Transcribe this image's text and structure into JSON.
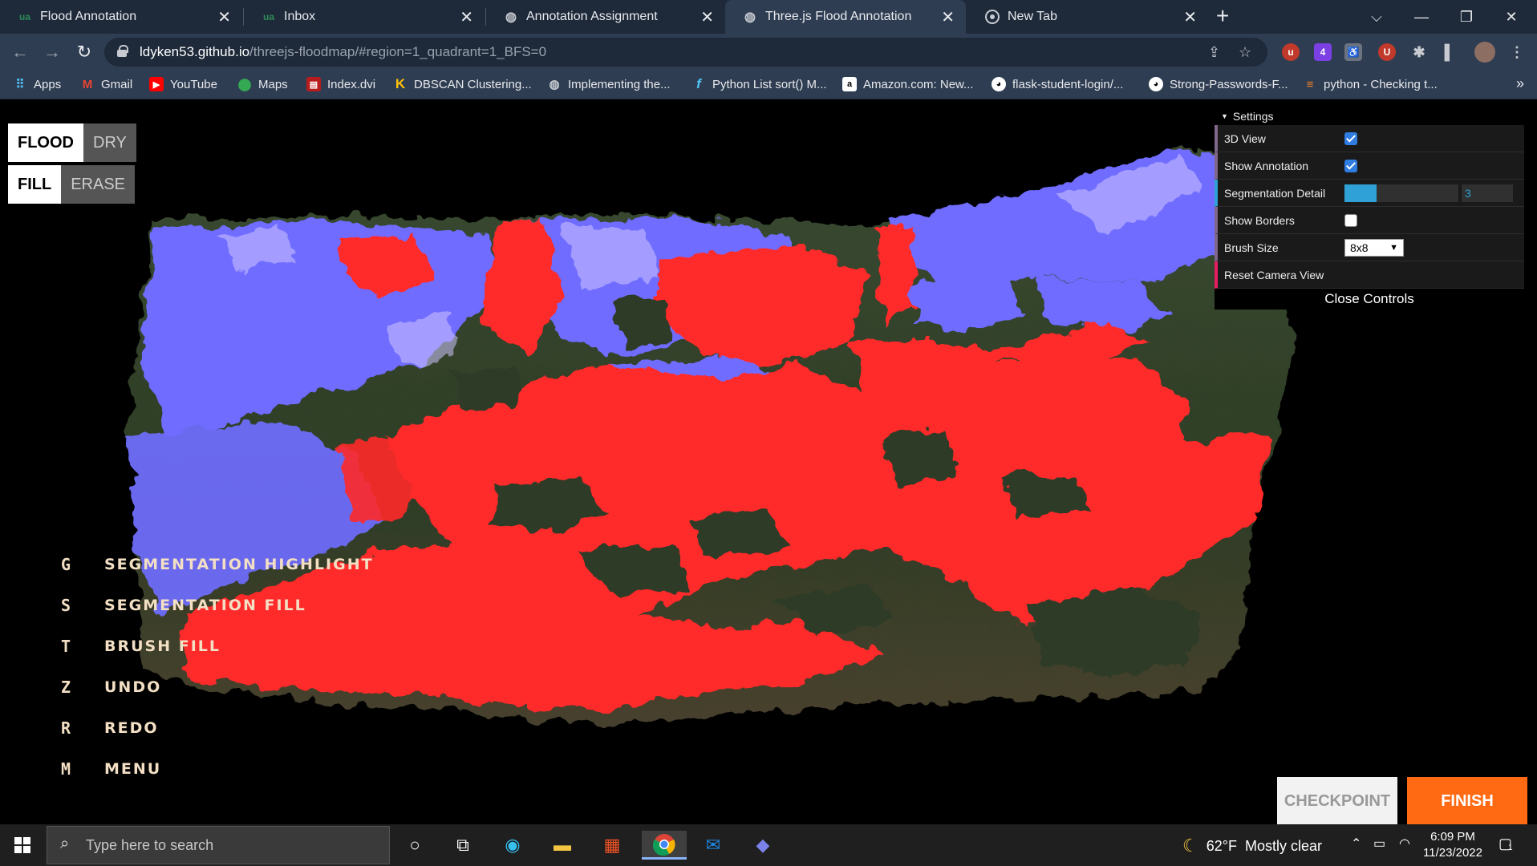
{
  "browser": {
    "tabs": [
      {
        "title": "Flood Annotation",
        "favicon": "ua-logo-icon",
        "active": false
      },
      {
        "title": "Inbox",
        "favicon": "ua-logo-icon",
        "active": false
      },
      {
        "title": "Annotation Assignment",
        "favicon": "globe-icon",
        "active": false
      },
      {
        "title": "Three.js Flood Annotation",
        "favicon": "globe-icon",
        "active": true
      },
      {
        "title": "New Tab",
        "favicon": "chrome-icon",
        "active": false
      }
    ],
    "url_host": "ldyken53.github.io",
    "url_path": "/threejs-floodmap/#region=1_quadrant=1_BFS=0",
    "extension_badge": "4",
    "bookmarks": [
      {
        "label": "Apps",
        "icon": "apps-grid-icon"
      },
      {
        "label": "Gmail",
        "icon": "gmail-icon"
      },
      {
        "label": "YouTube",
        "icon": "youtube-icon"
      },
      {
        "label": "Maps",
        "icon": "maps-icon"
      },
      {
        "label": "Index.dvi",
        "icon": "document-icon"
      },
      {
        "label": "DBSCAN Clustering...",
        "icon": "k-icon"
      },
      {
        "label": "Implementing the...",
        "icon": "globe-icon"
      },
      {
        "label": "Python List sort() M...",
        "icon": "f-icon"
      },
      {
        "label": "Amazon.com: New...",
        "icon": "amazon-icon"
      },
      {
        "label": "flask-student-login/...",
        "icon": "github-icon"
      },
      {
        "label": "Strong-Passwords-F...",
        "icon": "github-icon"
      },
      {
        "label": "python - Checking t...",
        "icon": "stackoverflow-icon"
      }
    ]
  },
  "app": {
    "mode_toggle": {
      "on": "FLOOD",
      "off": "DRY"
    },
    "tool_toggle": {
      "on": "FILL",
      "off": "ERASE"
    },
    "hotkeys": [
      {
        "key": "G",
        "label": "Segmentation Highlight"
      },
      {
        "key": "S",
        "label": "Segmentation Fill"
      },
      {
        "key": "T",
        "label": "Brush Fill"
      },
      {
        "key": "Z",
        "label": "Undo"
      },
      {
        "key": "R",
        "label": "Redo"
      },
      {
        "key": "M",
        "label": "Menu"
      }
    ],
    "settings": {
      "title": "Settings",
      "view_3d_label": "3D View",
      "view_3d": true,
      "show_annotation_label": "Show Annotation",
      "show_annotation": true,
      "segmentation_detail_label": "Segmentation Detail",
      "segmentation_detail": "3",
      "segmentation_detail_fraction": 0.28,
      "show_borders_label": "Show Borders",
      "show_borders": false,
      "brush_size_label": "Brush Size",
      "brush_size": "8x8",
      "reset_camera_label": "Reset Camera View",
      "close_label": "Close Controls"
    },
    "checkpoint_label": "CHECKPOINT",
    "finish_label": "FINISH",
    "colors": {
      "flood": "#ff2a2a",
      "dry": "#6f6cff",
      "finish": "#ff6a13"
    }
  },
  "taskbar": {
    "search_placeholder": "Type here to search",
    "weather_temp": "62°F",
    "weather_desc": "Mostly clear",
    "time": "6:09 PM",
    "date": "11/23/2022",
    "notifications": "1"
  }
}
